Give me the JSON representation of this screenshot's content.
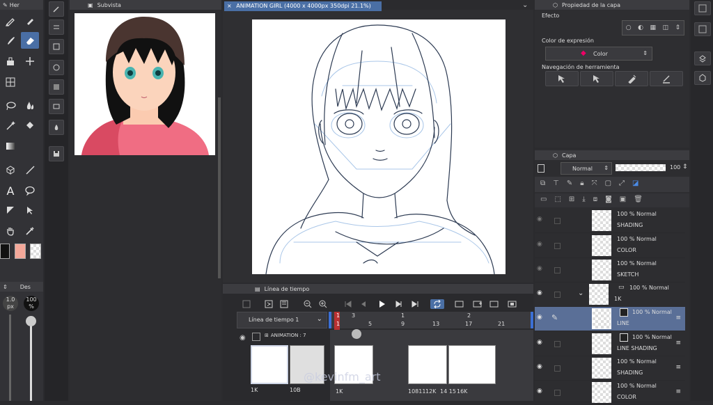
{
  "tool_palette": {
    "header": "Her"
  },
  "subview": {
    "title": "Subvista"
  },
  "canvas": {
    "tab_title": "ANIMATION GIRL (4000 x 4000px 350dpi 21.1%)"
  },
  "layer_property": {
    "title": "Propiedad de la capa",
    "effect_label": "Efecto",
    "expression_color_label": "Color de expresión",
    "expression_color_value": "Color",
    "tool_nav_label": "Navegación de herramienta"
  },
  "layer_panel": {
    "title": "Capa",
    "blend_mode": "Normal",
    "opacity": "100",
    "layers": [
      {
        "l1": "100 % Normal",
        "l2": "SHADING"
      },
      {
        "l1": "100 % Normal",
        "l2": "COLOR"
      },
      {
        "l1": "100 % Normal",
        "l2": "SKETCH"
      },
      {
        "l1": "100 % Normal",
        "l2": "1K"
      },
      {
        "l1": "100 % Normal",
        "l2": "LINE"
      },
      {
        "l1": "100 % Normal",
        "l2": "LINE SHADING"
      },
      {
        "l1": "100 % Normal",
        "l2": "SHADING"
      },
      {
        "l1": "100 % Normal",
        "l2": "COLOR"
      }
    ]
  },
  "brush_size": {
    "header": "Des",
    "size_value": "1.0",
    "size_unit": "px",
    "opacity_value": "100",
    "opacity_unit": "%"
  },
  "timeline": {
    "title": "Línea de tiempo",
    "name": "Línea de tiempo 1",
    "track_name": "ANIMATION : 7",
    "ruler_top": [
      "1",
      "3",
      "1",
      "2"
    ],
    "ruler_bottom": [
      "1",
      "5",
      "9",
      "13",
      "17",
      "21"
    ],
    "frame_labels": [
      "1K",
      "10B",
      "1K",
      "10811",
      "12K",
      "14 15",
      "16K"
    ]
  },
  "watermark": "@kevinfm_art",
  "colors": {
    "accent": "#4a6fa5",
    "playhead": "#d03030",
    "canvas_bg": "#ffffff"
  }
}
